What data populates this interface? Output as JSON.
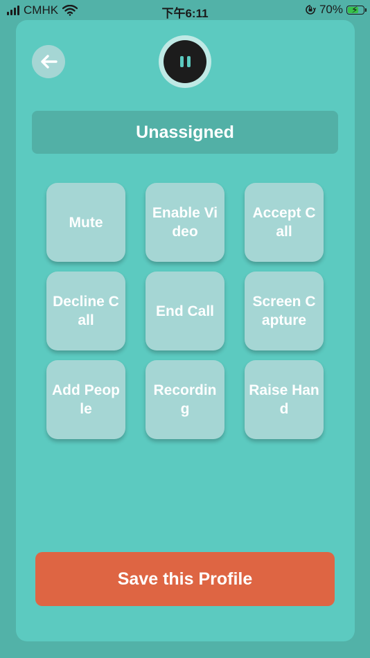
{
  "status_bar": {
    "carrier": "CMHK",
    "time": "下午6:11",
    "battery_percent": "70%",
    "battery_level": 0.7
  },
  "header": {
    "back_icon": "arrow-left-icon",
    "pause_icon": "pause-icon"
  },
  "profile": {
    "name": "Unassigned"
  },
  "actions": [
    {
      "label": "Mute"
    },
    {
      "label": "Enable Video"
    },
    {
      "label": "Accept Call"
    },
    {
      "label": "Decline Call"
    },
    {
      "label": "End Call"
    },
    {
      "label": "Screen Capture"
    },
    {
      "label": "Add People"
    },
    {
      "label": "Recording"
    },
    {
      "label": "Raise Hand"
    }
  ],
  "footer": {
    "save_label": "Save this Profile"
  },
  "colors": {
    "background": "#52b2a8",
    "panel": "#5ccac0",
    "tile": "#a5d6d4",
    "profile_bar": "#52b0a6",
    "save_button": "#de6543",
    "pause_button": "#1c1c1c"
  }
}
